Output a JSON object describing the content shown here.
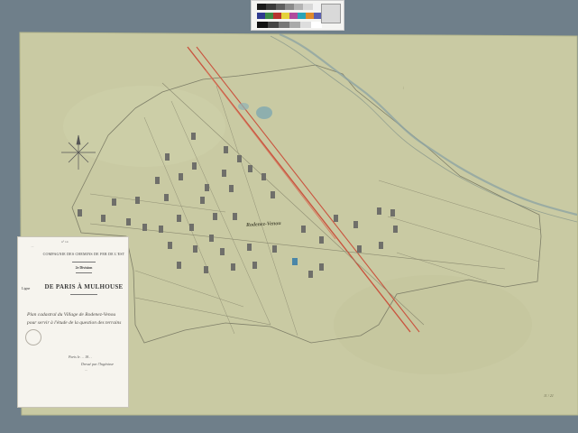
{
  "calibration_card": {
    "top_gray_steps": [
      "#1a1a1a",
      "#3a3a3a",
      "#5f5f5f",
      "#8a8a8a",
      "#b3b3b3",
      "#d8d8d8",
      "#f2f2f2"
    ],
    "color_patches": [
      "#2e3a8f",
      "#3c8c45",
      "#b7342e",
      "#e4d23a",
      "#b04a9c",
      "#2aa3b8",
      "#e08a2b",
      "#5a5fb0"
    ],
    "bottom_gray_steps": [
      "#111111",
      "#444444",
      "#777777",
      "#aaaaaa",
      "#dddddd",
      "#ffffff"
    ]
  },
  "cartouche": {
    "ref_number": "n° 14",
    "left_note": "…",
    "company": "Compagnie des chemins de fer de l'Est",
    "division": "2e Division",
    "ligne": "Ligne",
    "route": "DE PARIS À MULHOUSE",
    "handwritten_lines": [
      "Plan cadastral du Village de Rodenez-Venou",
      "pour servir à l'étude de la question des terrains"
    ],
    "sign_line_1": "Paris le … 18…",
    "sign_line_2": "Dressé par l'Ingénieur",
    "sign_line_3": "…"
  },
  "map": {
    "town_label": "Rodenez-Venou",
    "marginal_note": "…",
    "corner_mark": "11 / 21"
  },
  "colors": {
    "paper": "#c9caa3",
    "paper_edge": "#b6b88d",
    "rail_red": "#c9543f",
    "water": "#4a86a8",
    "building": "#6f6f6a",
    "line": "#7e7e68"
  }
}
